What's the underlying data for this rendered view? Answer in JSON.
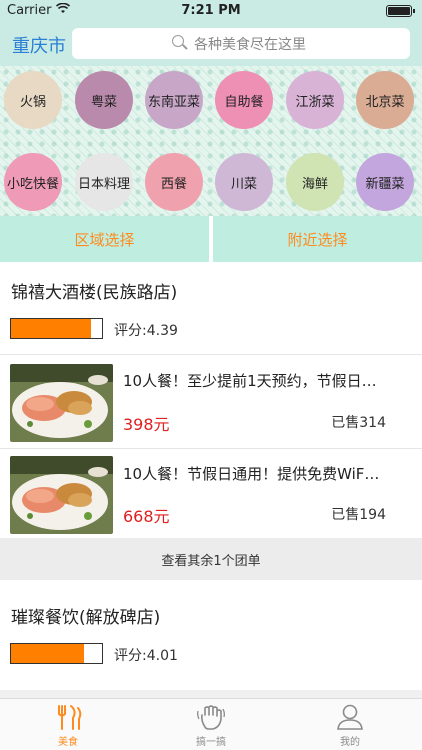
{
  "status_bar": {
    "carrier": "Carrier",
    "time": "7:21 PM"
  },
  "nav": {
    "city": "重庆市",
    "search_placeholder": "各种美食尽在这里"
  },
  "categories": [
    {
      "label": "火锅",
      "color": "#e8d9c4"
    },
    {
      "label": "粤菜",
      "color": "#b98aab"
    },
    {
      "label": "东南亚菜",
      "color": "#c8a6c8"
    },
    {
      "label": "自助餐",
      "color": "#ee8fb4"
    },
    {
      "label": "江浙菜",
      "color": "#d8b3d6"
    },
    {
      "label": "北京菜",
      "color": "#d9ac93"
    },
    {
      "label": "小吃快餐",
      "color": "#ef9bb8"
    },
    {
      "label": "日本料理",
      "color": "#e6e6e6"
    },
    {
      "label": "西餐",
      "color": "#f0a1ae"
    },
    {
      "label": "川菜",
      "color": "#cfb8d6"
    },
    {
      "label": "海鲜",
      "color": "#cfe3b3"
    },
    {
      "label": "新疆菜",
      "color": "#c3a6dd"
    }
  ],
  "filters": {
    "area": "区域选择",
    "nearby": "附近选择"
  },
  "shops": [
    {
      "name": "锦禧大酒楼(民族路店)",
      "rating_label": "评分:4.39",
      "rating_fraction": 0.88,
      "deals": [
        {
          "title": "10人餐！至少提前1天预约，节假日…",
          "price": "398元",
          "sold": "已售314"
        },
        {
          "title": "10人餐！节假日通用！提供免费WiF…",
          "price": "668元",
          "sold": "已售194"
        }
      ],
      "more_label": "查看其余1个团单"
    },
    {
      "name": "璀璨餐饮(解放碑店)",
      "rating_label": "评分:4.01",
      "rating_fraction": 0.8
    }
  ],
  "tabs": [
    {
      "label": "美食",
      "icon": "fork-knife-icon",
      "active": true
    },
    {
      "label": "搞一搞",
      "icon": "hand-icon",
      "active": false
    },
    {
      "label": "我的",
      "icon": "user-icon",
      "active": false
    }
  ],
  "colors": {
    "accent": "#ff8a1e",
    "price": "#e02020",
    "city": "#2a7fd6",
    "header_bg": "#c9ebe3"
  }
}
